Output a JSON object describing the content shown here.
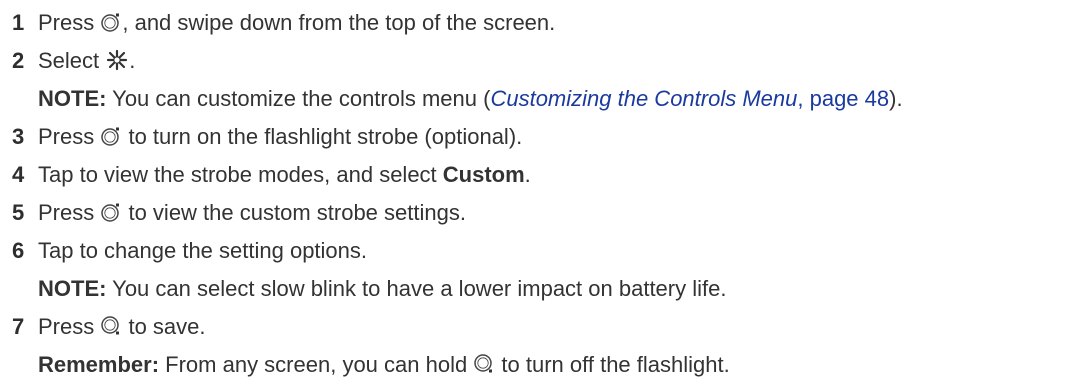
{
  "steps": [
    {
      "number": "1",
      "before": "Press ",
      "icon": "button-top-right-icon",
      "after": ", and swipe down from the top of the screen."
    },
    {
      "number": "2",
      "before": "Select ",
      "icon": "flashlight-icon",
      "after": ".",
      "note": {
        "label": "NOTE:",
        "text_before": " You can customize the controls menu (",
        "link_title": "Customizing the Controls Menu",
        "link_page": ", page 48",
        "text_after": ")."
      }
    },
    {
      "number": "3",
      "before": "Press ",
      "icon": "button-top-right-icon",
      "after": " to turn on the flashlight strobe (optional)."
    },
    {
      "number": "4",
      "before": "Tap to view the strobe modes, and select ",
      "bold": "Custom",
      "after": "."
    },
    {
      "number": "5",
      "before": "Press ",
      "icon": "button-top-right-icon",
      "after": " to view the custom strobe settings."
    },
    {
      "number": "6",
      "text": "Tap to change the setting options.",
      "note": {
        "label": "NOTE:",
        "text": " You can select slow blink to have a lower impact on battery life."
      }
    },
    {
      "number": "7",
      "before": "Press ",
      "icon": "button-bottom-right-icon",
      "after": " to save."
    }
  ],
  "remember": {
    "label": "Remember:",
    "before": " From any screen, you can hold ",
    "icon": "button-bottom-right-icon",
    "after": " to turn off the flashlight."
  }
}
